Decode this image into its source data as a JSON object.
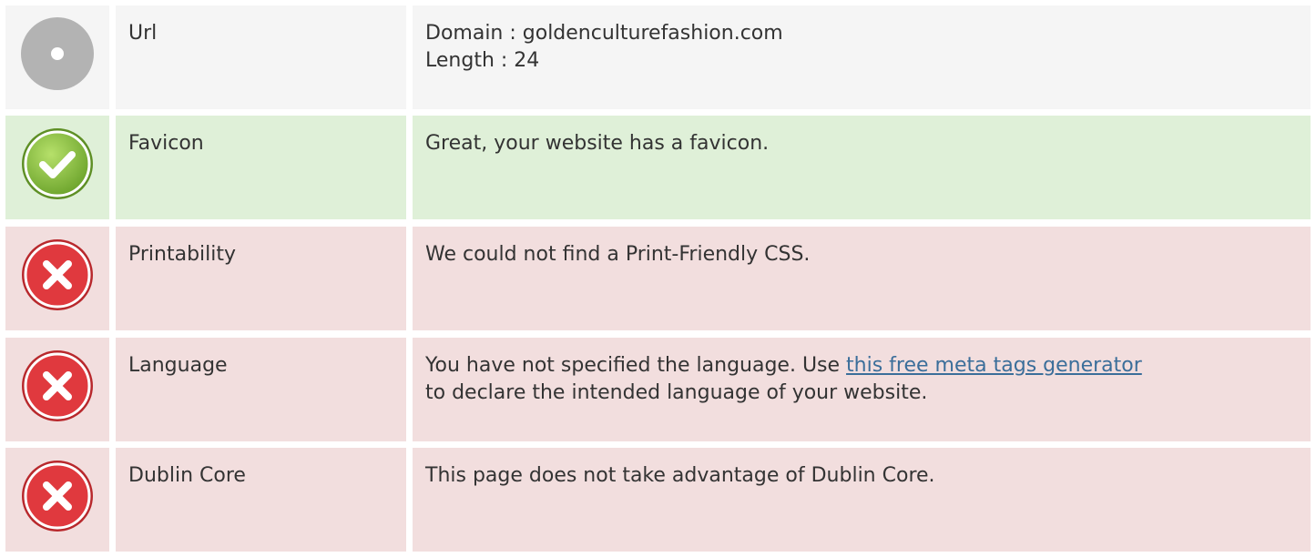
{
  "rows": [
    {
      "status": "neutral",
      "icon": "info-neutral-icon",
      "label": "Url",
      "lines": [
        "Domain : goldenculturefashion.com",
        "Length : 24"
      ]
    },
    {
      "status": "success",
      "icon": "check-icon",
      "label": "Favicon",
      "text": "Great, your website has a favicon."
    },
    {
      "status": "error",
      "icon": "error-x-icon",
      "label": "Printability",
      "text": "We could not find a Print-Friendly CSS."
    },
    {
      "status": "error",
      "icon": "error-x-icon",
      "label": "Language",
      "text_before": "You have not specified the language. Use ",
      "link_text": "this free meta tags generator",
      "text_after": "to declare the intended language of your website."
    },
    {
      "status": "error",
      "icon": "error-x-icon",
      "label": "Dublin Core",
      "text": "This page does not take advantage of Dublin Core."
    }
  ],
  "colors": {
    "neutral_bg": "#f5f5f5",
    "success_bg": "#dff0d8",
    "error_bg": "#f2dede",
    "link": "#3b6e9a",
    "success_icon": "#8cc63f",
    "error_icon": "#e0393e",
    "neutral_icon": "#b3b3b3"
  }
}
